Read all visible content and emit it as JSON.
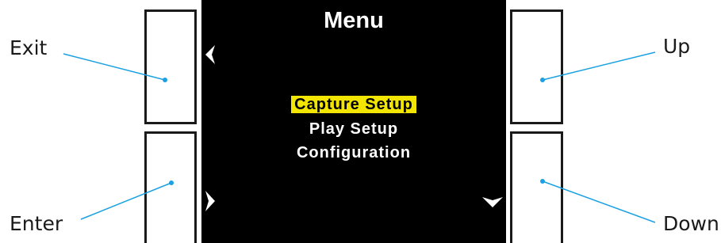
{
  "labels": {
    "exit": "Exit",
    "enter": "Enter",
    "up": "Up",
    "down": "Down"
  },
  "screen": {
    "title": "Menu",
    "menu_items": [
      {
        "label": "Capture Setup",
        "selected": true
      },
      {
        "label": "Play Setup",
        "selected": false
      },
      {
        "label": "Configuration",
        "selected": false
      }
    ],
    "icons": {
      "exit": "chevron-left-icon",
      "enter": "chevron-right-icon",
      "down": "chevron-down-icon"
    }
  },
  "colors": {
    "screen_bg": "#000000",
    "selection_highlight": "#f2e500",
    "callout_line": "#1ba1e2"
  }
}
